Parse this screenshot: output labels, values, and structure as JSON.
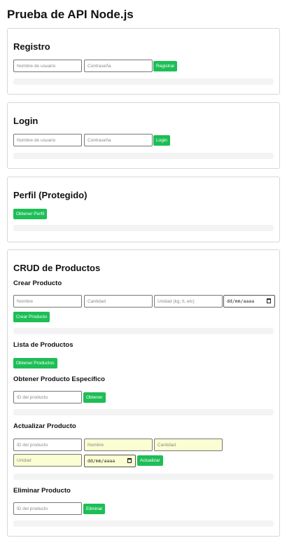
{
  "page_title": "Prueba de API Node.js",
  "registro": {
    "title": "Registro",
    "username_placeholder": "Nombre de usuario",
    "password_placeholder": "Contraseña",
    "button": "Registrar"
  },
  "login": {
    "title": "Login",
    "username_placeholder": "Nombre de usuario",
    "password_placeholder": "Contraseña",
    "button": "Login"
  },
  "perfil": {
    "title": "Perfil (Protegido)",
    "button": "Obtener Perfil"
  },
  "crud": {
    "title": "CRUD de Productos",
    "crear": {
      "title": "Crear Producto",
      "nombre_placeholder": "Nombre",
      "cantidad_placeholder": "Cantidad",
      "unidad_placeholder": "Unidad (kg, lt, etc)",
      "date_placeholder": "dd/mm/aaaa",
      "button": "Crear Producto"
    },
    "lista": {
      "title": "Lista de Productos",
      "button": "Obtener Productos"
    },
    "obtener": {
      "title": "Obtener Producto Específico",
      "id_placeholder": "ID del producto",
      "button": "Obtener"
    },
    "actualizar": {
      "title": "Actualizar Producto",
      "id_placeholder": "ID del producto",
      "nombre_placeholder": "Nombre",
      "cantidad_placeholder": "Cantidad",
      "unidad_placeholder": "Unidad",
      "date_placeholder": "dd/mm/aaaa",
      "button": "Actualizar"
    },
    "eliminar": {
      "title": "Eliminar Producto",
      "id_placeholder": "ID del producto",
      "button": "Eliminar"
    }
  },
  "colors": {
    "button_green": "#1dbe56",
    "highlight_input": "#fbfdd2",
    "result_box": "#f3f3f3",
    "card_border": "#d7d7d7"
  },
  "icons": {
    "date_picker": "calendar-icon"
  }
}
